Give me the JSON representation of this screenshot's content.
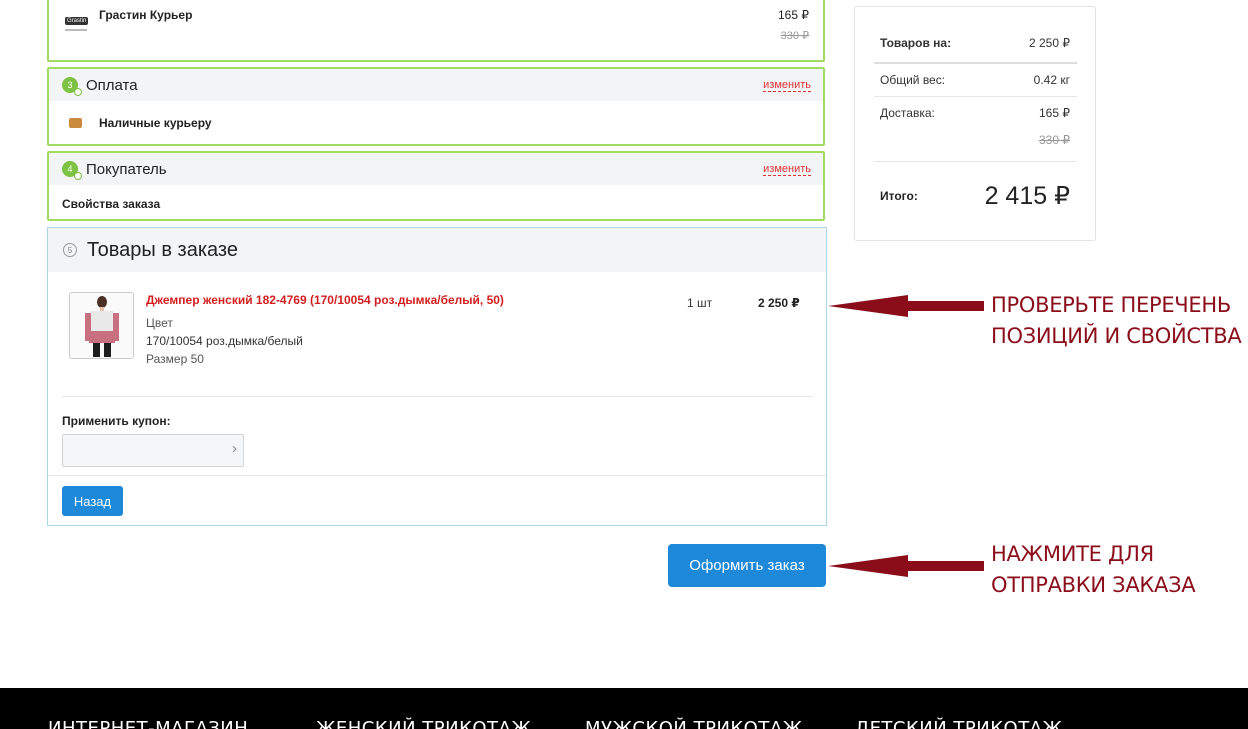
{
  "delivery": {
    "name": "Грастин Курьер",
    "logo_text": "Grastin",
    "price": "165 ₽",
    "old_price": "330 ₽"
  },
  "payment": {
    "step": "3",
    "title": "Оплата",
    "change_label": "изменить",
    "method": "Наличные курьеру"
  },
  "buyer": {
    "step": "4",
    "title": "Покупатель",
    "change_label": "изменить",
    "props_label": "Свойства заказа"
  },
  "order_items": {
    "step": "5",
    "title": "Товары в заказе",
    "items": [
      {
        "name": "Джемпер женский 182-4769 (170/10054 роз.дымка/белый, 50)",
        "color_label": "Цвет",
        "color_value": "170/10054 роз.дымка/белый",
        "size_label": "Размер",
        "size_value": "50",
        "qty": "1 шт",
        "price": "2 250 ₽"
      }
    ],
    "coupon_label": "Применить купон:",
    "coupon_value": "",
    "back_label": "Назад"
  },
  "submit_label": "Оформить заказ",
  "summary": {
    "goods_label": "Товаров на:",
    "goods_value": "2 250 ₽",
    "weight_label": "Общий вес:",
    "weight_value": "0.42 кг",
    "delivery_label": "Доставка:",
    "delivery_value": "165 ₽",
    "delivery_old": "330 ₽",
    "total_label": "Итого:",
    "total_value": "2 415 ₽"
  },
  "annotations": {
    "check_line1": "ПРОВЕРЬТЕ ПЕРЕЧЕНЬ",
    "check_line2": "ПОЗИЦИЙ И СВОЙСТВА",
    "submit_line1": "НАЖМИТЕ ДЛЯ",
    "submit_line2": "ОТПРАВКИ ЗАКАЗА",
    "color": "#8b0d1a"
  },
  "footer": {
    "items": [
      "ИНТЕРНЕТ-МАГАЗИН",
      "ЖЕНСКИЙ ТРИКОТАЖ",
      "МУЖСКОЙ ТРИКОТАЖ",
      "ДЕТСКИЙ ТРИКОТАЖ"
    ]
  },
  "colors": {
    "accent_green": "#9fdc5f",
    "accent_blue": "#1e88d9",
    "link_red": "#d33"
  }
}
